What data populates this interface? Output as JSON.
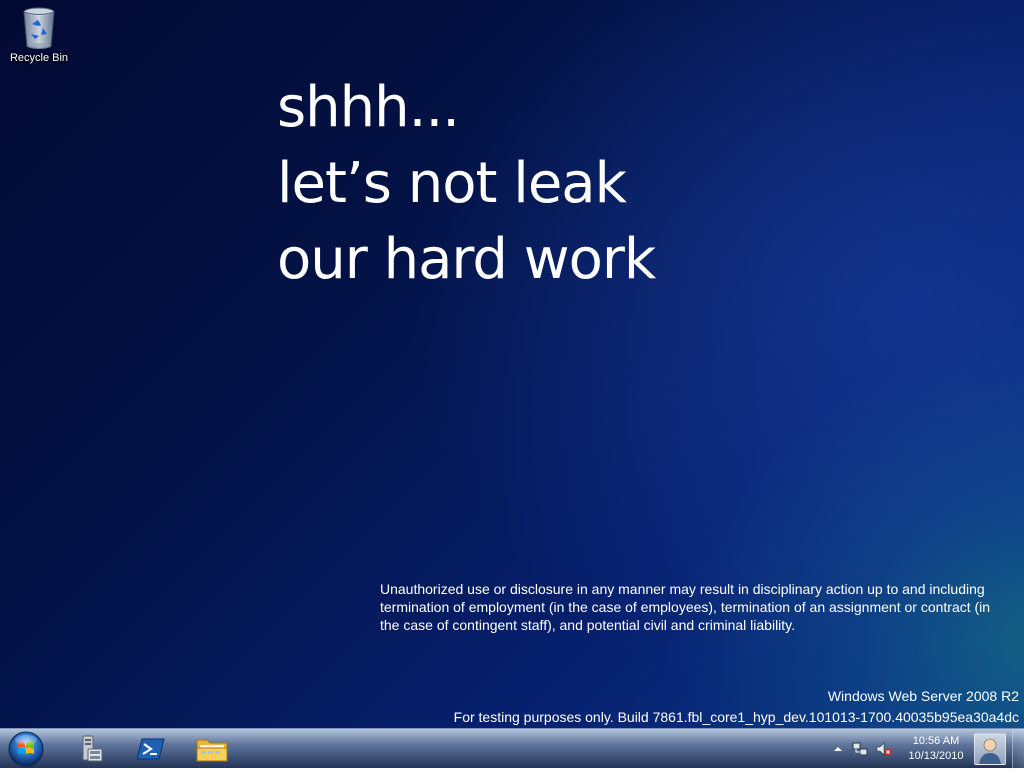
{
  "desktop": {
    "recycle_bin": {
      "label": "Recycle Bin",
      "icon": "recycle-bin-icon"
    },
    "headline": [
      "shhh...",
      "let’s not leak",
      "our hard work"
    ],
    "disclaimer": "Unauthorized use or disclosure in any manner may result in disciplinary action up to and including termination of employment (in the case of employees), termination of an assignment or contract (in the case of contingent staff), and potential civil and criminal liability.",
    "watermark": {
      "os_name": "Windows Web Server 2008 R2",
      "build": "For testing purposes only. Build 7861.fbl_core1_hyp_dev.101013-1700.40035b95ea30a4dc"
    }
  },
  "taskbar": {
    "start_icon": "windows-orb-icon",
    "pinned": [
      {
        "name": "server-manager",
        "icon": "server-manager-icon"
      },
      {
        "name": "powershell",
        "icon": "powershell-icon"
      },
      {
        "name": "windows-explorer",
        "icon": "folder-icon"
      }
    ],
    "tray": {
      "icons": [
        "show-hidden-icons-arrow",
        "network-icon",
        "volume-muted-icon"
      ],
      "time": "10:56 AM",
      "date": "10/13/2010"
    },
    "user_icon": "user-avatar-icon"
  },
  "colors": {
    "desktop_dark": "#020a33",
    "desktop_mid": "#06206e",
    "teal_glow": "#146e82",
    "text": "#ffffff"
  }
}
